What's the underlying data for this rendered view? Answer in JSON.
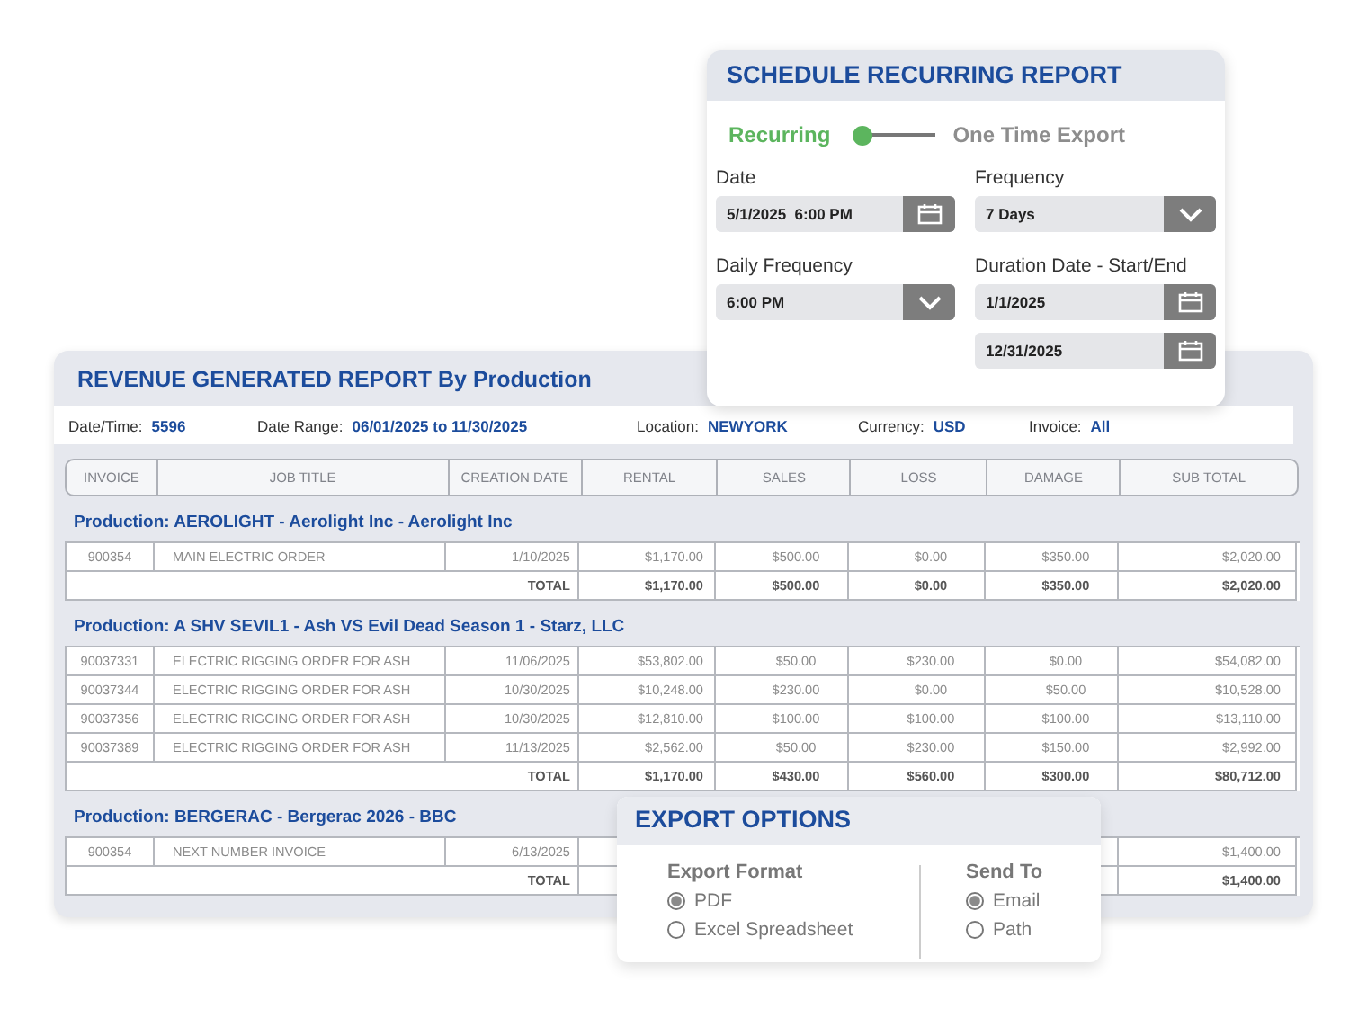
{
  "report": {
    "title": "REVENUE GENERATED REPORT By Production",
    "filters": [
      {
        "label": "Date/Time:",
        "value": "5596"
      },
      {
        "label": "Date Range:",
        "value": "06/01/2025 to 11/30/2025"
      },
      {
        "label": "Location:",
        "value": "NEWYORK"
      },
      {
        "label": "Currency:",
        "value": "USD"
      },
      {
        "label": "Invoice:",
        "value": "All"
      }
    ],
    "columns": [
      "INVOICE",
      "JOB TITLE",
      "CREATION DATE",
      "RENTAL",
      "SALES",
      "LOSS",
      "DAMAGE",
      "SUB TOTAL"
    ],
    "groups": [
      {
        "title": "Production: AEROLIGHT - Aerolight Inc - Aerolight Inc",
        "rows": [
          [
            "900354",
            "MAIN ELECTRIC ORDER",
            "1/10/2025",
            "$1,170.00",
            "$500.00",
            "$0.00",
            "$350.00",
            "$2,020.00"
          ]
        ],
        "total": {
          "label": "TOTAL",
          "cells": [
            "$1,170.00",
            "$500.00",
            "$0.00",
            "$350.00",
            "$2,020.00"
          ]
        }
      },
      {
        "title": "Production: A SHV SEVIL1 - Ash VS Evil Dead Season 1 - Starz, LLC",
        "rows": [
          [
            "90037331",
            "ELECTRIC RIGGING ORDER FOR ASH",
            "11/06/2025",
            "$53,802.00",
            "$50.00",
            "$230.00",
            "$0.00",
            "$54,082.00"
          ],
          [
            "90037344",
            "ELECTRIC RIGGING ORDER FOR ASH",
            "10/30/2025",
            "$10,248.00",
            "$230.00",
            "$0.00",
            "$50.00",
            "$10,528.00"
          ],
          [
            "90037356",
            "ELECTRIC RIGGING ORDER FOR ASH",
            "10/30/2025",
            "$12,810.00",
            "$100.00",
            "$100.00",
            "$100.00",
            "$13,110.00"
          ],
          [
            "90037389",
            "ELECTRIC RIGGING ORDER FOR ASH",
            "11/13/2025",
            "$2,562.00",
            "$50.00",
            "$230.00",
            "$150.00",
            "$2,992.00"
          ]
        ],
        "total": {
          "label": "TOTAL",
          "cells": [
            "$1,170.00",
            "$430.00",
            "$560.00",
            "$300.00",
            "$80,712.00"
          ]
        }
      },
      {
        "title": "Production: BERGERAC - Bergerac 2026 - BBC",
        "rows": [
          [
            "900354",
            "NEXT NUMBER INVOICE",
            "6/13/2025",
            null,
            null,
            null,
            null,
            "$1,400.00"
          ]
        ],
        "total": {
          "label": "TOTAL",
          "cells": [
            null,
            null,
            null,
            null,
            "$1,400.00"
          ]
        }
      }
    ]
  },
  "schedule": {
    "title": "SCHEDULE RECURRING REPORT",
    "mode_toggle": [
      {
        "label": "Recurring",
        "selected": true
      },
      {
        "label": "One Time Export",
        "selected": false
      }
    ],
    "fields": [
      {
        "label": "Date",
        "inputs": [
          {
            "kind": "date",
            "value": "5/1/2025  6:00 PM"
          }
        ]
      },
      {
        "label": "Frequency",
        "inputs": [
          {
            "kind": "dropdown",
            "value": "7 Days"
          }
        ]
      },
      {
        "label": "Daily Frequency",
        "inputs": [
          {
            "kind": "dropdown",
            "value": "6:00 PM"
          }
        ]
      },
      {
        "label": "Duration Date - Start/End",
        "inputs": [
          {
            "kind": "date",
            "value": "1/1/2025"
          },
          {
            "kind": "date",
            "value": "12/31/2025"
          }
        ]
      }
    ]
  },
  "export_options": {
    "title": "EXPORT OPTIONS",
    "groups": [
      {
        "label": "Export Format",
        "options": [
          {
            "label": "PDF",
            "selected": true
          },
          {
            "label": "Excel Spreadsheet",
            "selected": false
          }
        ]
      },
      {
        "label": "Send To",
        "options": [
          {
            "label": "Email",
            "selected": true
          },
          {
            "label": "Path",
            "selected": false
          }
        ]
      }
    ]
  }
}
